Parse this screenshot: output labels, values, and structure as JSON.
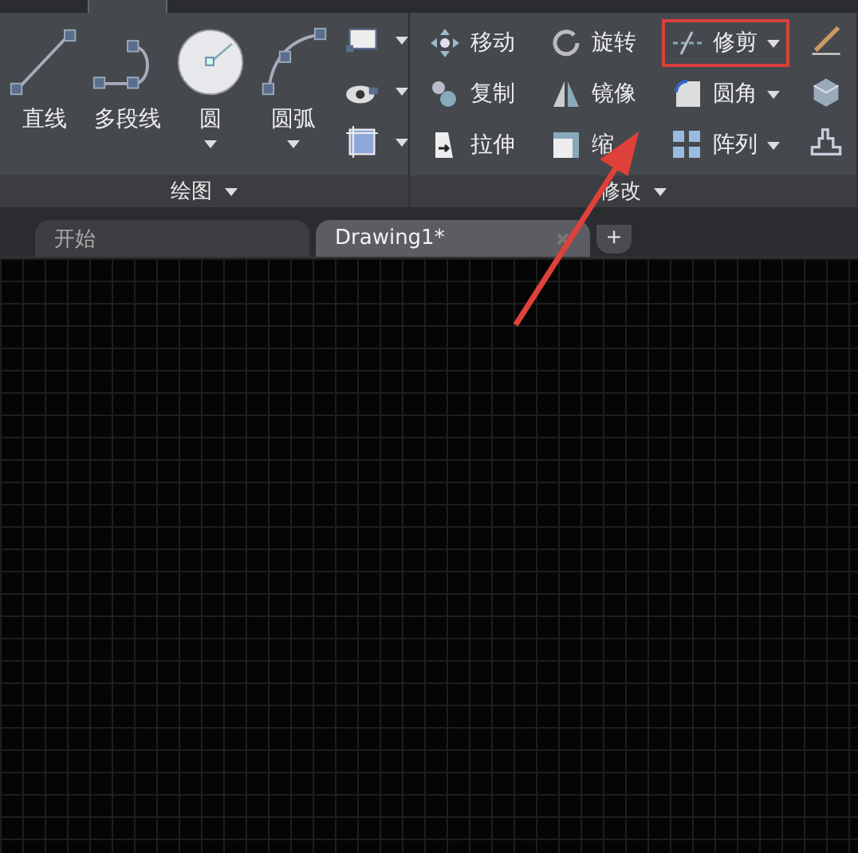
{
  "ribbon": {
    "panels": [
      {
        "title": "绘图",
        "large_tools": [
          {
            "label": "直线",
            "kind": "line",
            "dropdown": false
          },
          {
            "label": "多段线",
            "kind": "polyline",
            "dropdown": false
          },
          {
            "label": "圆",
            "kind": "circle",
            "dropdown": true
          },
          {
            "label": "圆弧",
            "kind": "arc",
            "dropdown": true
          }
        ],
        "small_tools": [
          {
            "kind": "rect",
            "dropdown": true
          },
          {
            "kind": "hatch",
            "dropdown": true
          },
          {
            "kind": "region",
            "dropdown": true
          }
        ]
      },
      {
        "title": "修改",
        "columns": [
          [
            {
              "label": "移动",
              "kind": "move",
              "dropdown": false,
              "highlighted": false
            },
            {
              "label": "复制",
              "kind": "copy",
              "dropdown": false,
              "highlighted": false
            },
            {
              "label": "拉伸",
              "kind": "stretch",
              "dropdown": false,
              "highlighted": false
            }
          ],
          [
            {
              "label": "旋转",
              "kind": "rotate",
              "dropdown": false,
              "highlighted": false
            },
            {
              "label": "镜像",
              "kind": "mirror",
              "dropdown": false,
              "highlighted": false
            },
            {
              "label": "缩",
              "kind": "scale",
              "dropdown": false,
              "highlighted": false
            }
          ],
          [
            {
              "label": "修剪",
              "kind": "trim",
              "dropdown": true,
              "highlighted": true
            },
            {
              "label": "圆角",
              "kind": "fillet",
              "dropdown": true,
              "highlighted": false
            },
            {
              "label": "阵列",
              "kind": "array",
              "dropdown": true,
              "highlighted": false
            }
          ]
        ],
        "small_tools": [
          {
            "kind": "brush"
          },
          {
            "kind": "cube"
          },
          {
            "kind": "offset"
          }
        ]
      }
    ]
  },
  "file_tabs": [
    {
      "label": "开始",
      "selected": false,
      "closable": false
    },
    {
      "label": "Drawing1*",
      "selected": true,
      "closable": true
    }
  ],
  "new_tab": "+"
}
